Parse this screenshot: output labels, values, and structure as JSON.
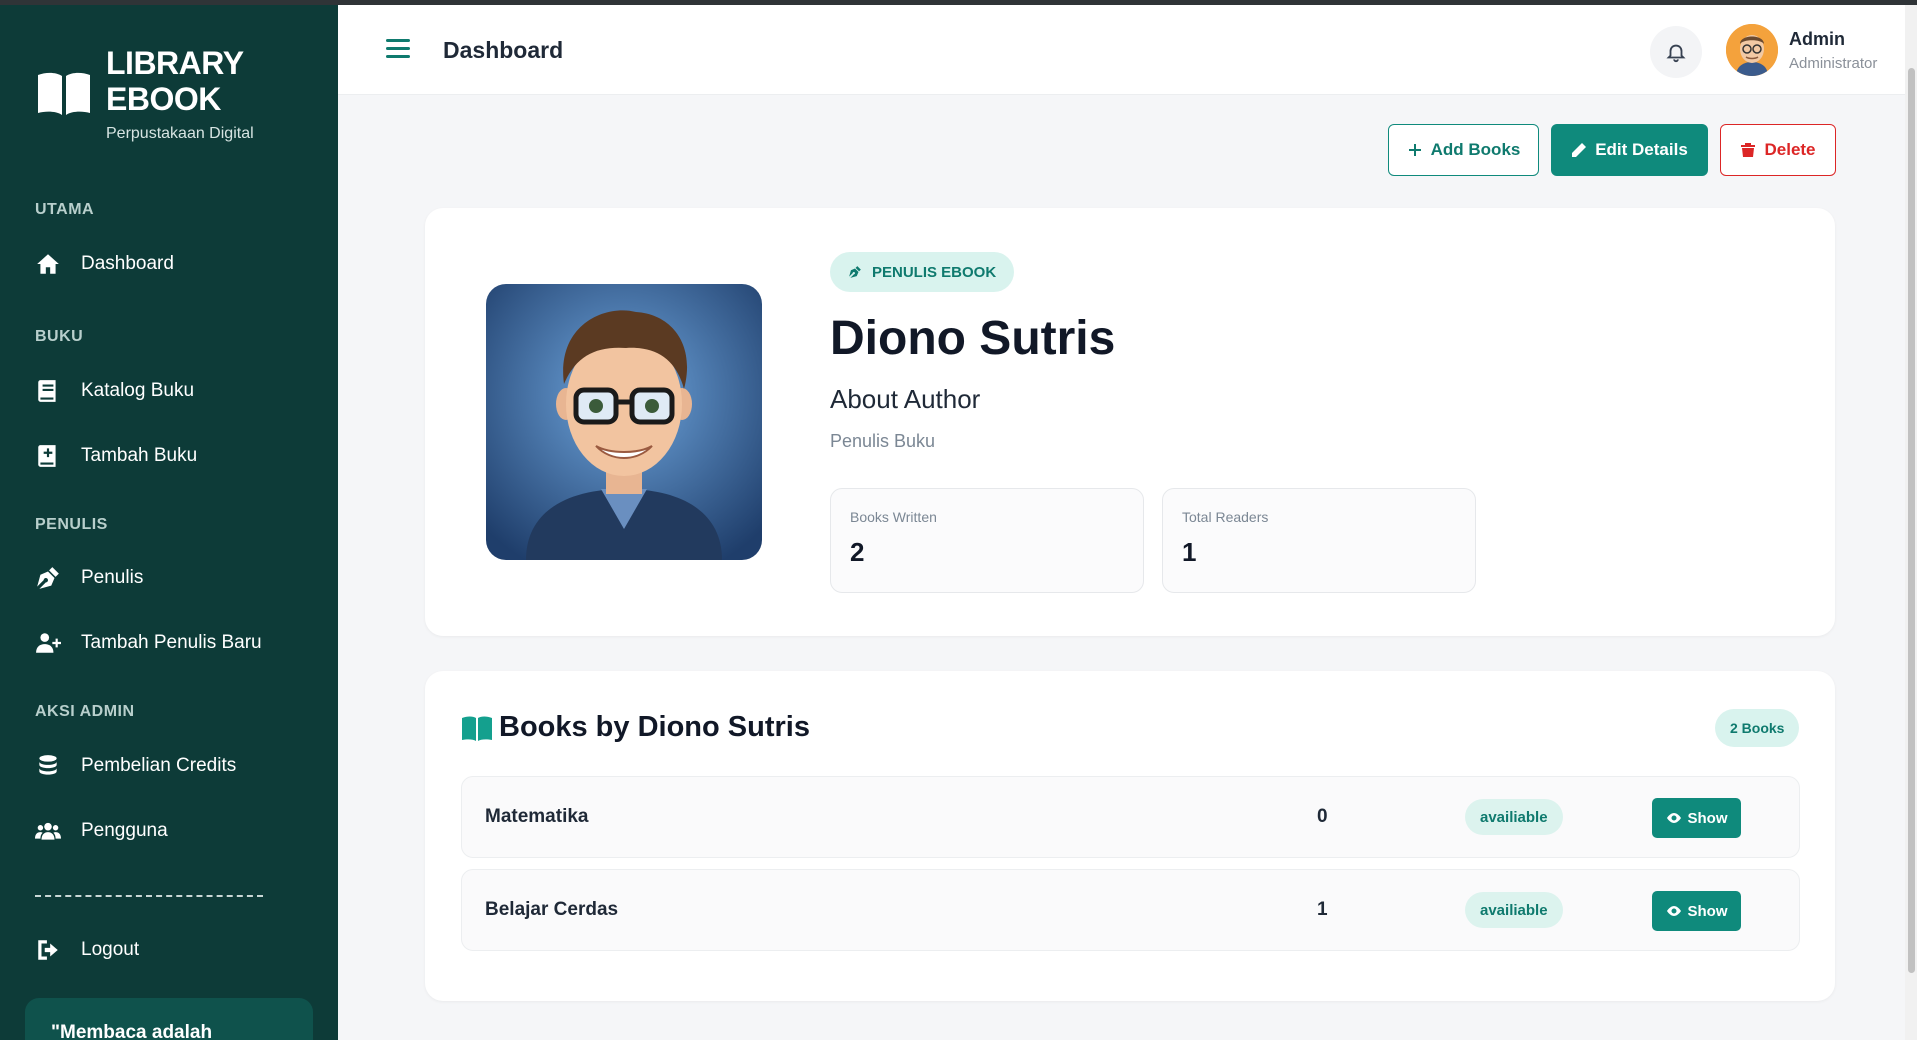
{
  "sidebar": {
    "brand_title": "LIBRARY EBOOK",
    "brand_subtitle": "Perpustakaan Digital",
    "sections": {
      "utama": "UTAMA",
      "buku": "BUKU",
      "penulis": "PENULIS",
      "aksi_admin": "AKSI ADMIN"
    },
    "items": [
      {
        "label": "Dashboard",
        "icon": "home-icon"
      },
      {
        "label": "Katalog Buku",
        "icon": "book-icon"
      },
      {
        "label": "Tambah Buku",
        "icon": "book-plus-icon"
      },
      {
        "label": "Penulis",
        "icon": "pen-nib-icon"
      },
      {
        "label": "Tambah Penulis Baru",
        "icon": "user-plus-icon"
      },
      {
        "label": "Pembelian Credits",
        "icon": "coins-icon"
      },
      {
        "label": "Pengguna",
        "icon": "users-icon"
      }
    ],
    "divider_text": "------------------------------",
    "logout_label": "Logout",
    "quote_text": "\"Membaca adalah"
  },
  "header": {
    "page_title": "Dashboard",
    "user_name": "Admin",
    "user_role": "Administrator"
  },
  "actions": {
    "add_label": "Add Books",
    "edit_label": "Edit Details",
    "delete_label": "Delete"
  },
  "author": {
    "badge": "PENULIS EBOOK",
    "name": "Diono Sutris",
    "about_heading": "About Author",
    "role": "Penulis Buku",
    "stats": [
      {
        "label": "Books Written",
        "value": "2"
      },
      {
        "label": "Total Readers",
        "value": "1"
      }
    ]
  },
  "books": {
    "title": "Books by Diono Sutris",
    "count_badge": "2 Books",
    "show_label": "Show",
    "rows": [
      {
        "title": "Matematika",
        "readers": "0",
        "status": "availiable"
      },
      {
        "title": "Belajar Cerdas",
        "readers": "1",
        "status": "availiable"
      }
    ]
  },
  "colors": {
    "sidebar_bg": "#0d3b38",
    "accent": "#0f8a7c",
    "danger": "#dc2626",
    "badge_bg": "#d9f3ee"
  }
}
